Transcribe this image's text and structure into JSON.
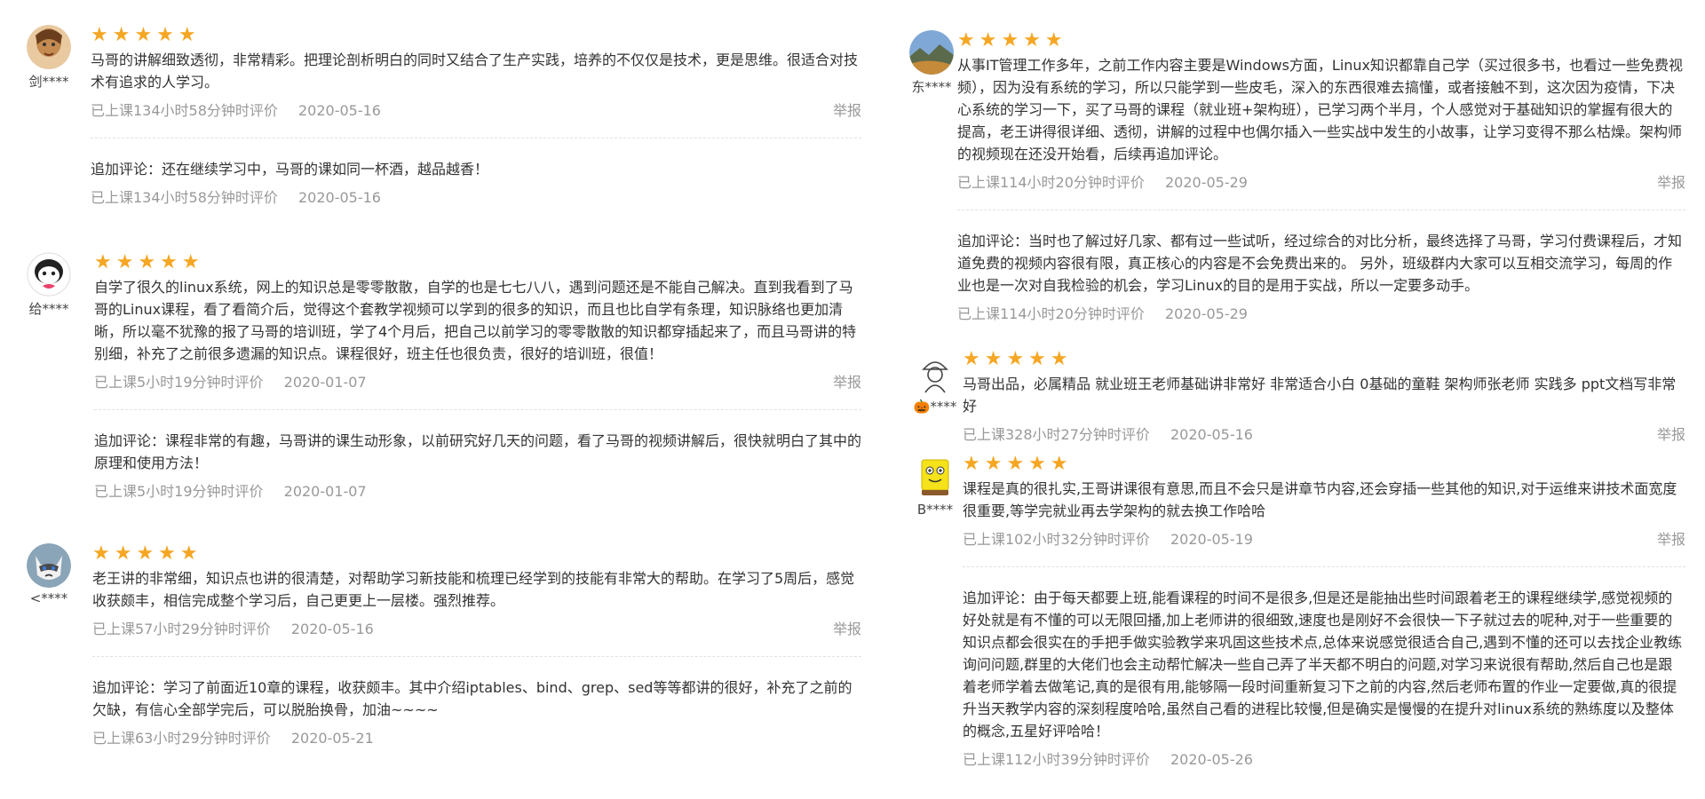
{
  "left": {
    "reviews": [
      {
        "user": "剑****",
        "avatar": "portrait",
        "stars": "★★★★★",
        "text": "马哥的讲解细致透彻，非常精彩。把理论剖析明白的同时又结合了生产实践，培养的不仅仅是技术，更是思维。很适合对技术有追求的人学习。",
        "hours": "已上课134小时58分钟时评价",
        "date": "2020-05-16",
        "report": "举报",
        "follow_text": "追加评论：还在继续学习中，马哥的课如同一杯酒，越品越香！",
        "follow_hours": "已上课134小时58分钟时评价",
        "follow_date": "2020-05-16"
      },
      {
        "user": "给****",
        "avatar": "cartoon",
        "stars": "★★★★★",
        "text": "自学了很久的linux系统，网上的知识总是零零散散，自学的也是七七八八，遇到问题还是不能自己解决。直到我看到了马哥的Linux课程，看了看简介后，觉得这个套教学视频可以学到的很多的知识，而且也比自学有条理，知识脉络也更加清晰，所以毫不犹豫的报了马哥的培训班，学了4个月后，把自己以前学习的零零散散的知识都穿插起来了，而且马哥讲的特别细，补充了之前很多遗漏的知识点。课程很好，班主任也很负责，很好的培训班，很值！",
        "hours": "已上课5小时19分钟时评价",
        "date": "2020-01-07",
        "report": "举报",
        "follow_text": "追加评论：课程非常的有趣，马哥讲的课生动形象，以前研究好几天的问题，看了马哥的视频讲解后，很快就明白了其中的原理和使用方法！",
        "follow_hours": "已上课5小时19分钟时评价",
        "follow_date": "2020-01-07"
      },
      {
        "user": "<****",
        "avatar": "cat",
        "stars": "★★★★★",
        "text": "老王讲的非常细，知识点也讲的很清楚，对帮助学习新技能和梳理已经学到的技能有非常大的帮助。在学习了5周后，感觉收获颇丰，相信完成整个学习后，自己更更上一层楼。强烈推荐。",
        "hours": "已上课57小时29分钟时评价",
        "date": "2020-05-16",
        "report": "举报",
        "follow_text": "追加评论：学习了前面近10章的课程，收获颇丰。其中介绍iptables、bind、grep、sed等等都讲的很好，补充了之前的欠缺，有信心全部学完后，可以脱胎换骨，加油~~~~",
        "follow_hours": "已上课63小时29分钟时评价",
        "follow_date": "2020-05-21"
      }
    ]
  },
  "right": {
    "reviews": [
      {
        "user": "东****",
        "avatar": "landscape",
        "stars": "★★★★★",
        "text": "从事IT管理工作多年，之前工作内容主要是Windows方面，Linux知识都靠自己学（买过很多书，也看过一些免费视频），因为没有系统的学习，所以只能学到一些皮毛，深入的东西很难去搞懂，或者接触不到，这次因为疫情，下决心系统的学习一下，买了马哥的课程（就业班+架构班），已学习两个半月，个人感觉对于基础知识的掌握有很大的提高，老王讲得很详细、透彻，讲解的过程中也偶尔插入一些实战中发生的小故事，让学习变得不那么枯燥。架构师的视频现在还没开始看，后续再追加评论。",
        "hours": "已上课114小时20分钟时评价",
        "date": "2020-05-29",
        "report": "举报",
        "follow_text": "追加评论：当时也了解过好几家、都有过一些试听，经过综合的对比分析，最终选择了马哥，学习付费课程后，才知道免费的视频内容很有限，真正核心的内容是不会免费出来的。 另外，班级群内大家可以互相交流学习，每周的作业也是一次对自我检验的机会，学习Linux的目的是用于实战，所以一定要多动手。",
        "follow_hours": "已上课114小时20分钟时评价",
        "follow_date": "2020-05-29"
      },
      {
        "user": "🎃****",
        "avatar": "sketch",
        "stars": "★★★★★",
        "text": "马哥出品，必属精品 就业班王老师基础讲非常好 非常适合小白 0基础的童鞋 架构师张老师 实践多 ppt文档写非常好",
        "hours": "已上课328小时27分钟时评价",
        "date": "2020-05-16",
        "report": "举报"
      },
      {
        "user": "B****",
        "avatar": "sponge",
        "stars": "★★★★★",
        "text": "课程是真的很扎实,王哥讲课很有意思,而且不会只是讲章节内容,还会穿插一些其他的知识,对于运维来讲技术面宽度很重要,等学完就业再去学架构的就去换工作哈哈",
        "hours": "已上课102小时32分钟时评价",
        "date": "2020-05-19",
        "report": "举报",
        "follow_text": "追加评论：由于每天都要上班,能看课程的时间不是很多,但是还是能抽出些时间跟着老王的课程继续学,感觉视频的好处就是有不懂的可以无限回播,加上老师讲的很细致,速度也是刚好不会很快一下子就过去的呢种,对于一些重要的知识点都会很实在的手把手做实验教学来巩固这些技术点,总体来说感觉很适合自己,遇到不懂的还可以去找企业教练询问问题,群里的大佬们也会主动帮忙解决一些自己弄了半天都不明白的问题,对学习来说很有帮助,然后自己也是跟着老师学着去做笔记,真的是很有用,能够隔一段时间重新复习下之前的内容,然后老师布置的作业一定要做,真的很提升当天教学内容的深刻程度哈哈,虽然自己看的进程比较慢,但是确实是慢慢的在提升对linux系统的熟练度以及整体的概念,五星好评哈哈！",
        "follow_hours": "已上课112小时39分钟时评价",
        "follow_date": "2020-05-26"
      }
    ]
  }
}
